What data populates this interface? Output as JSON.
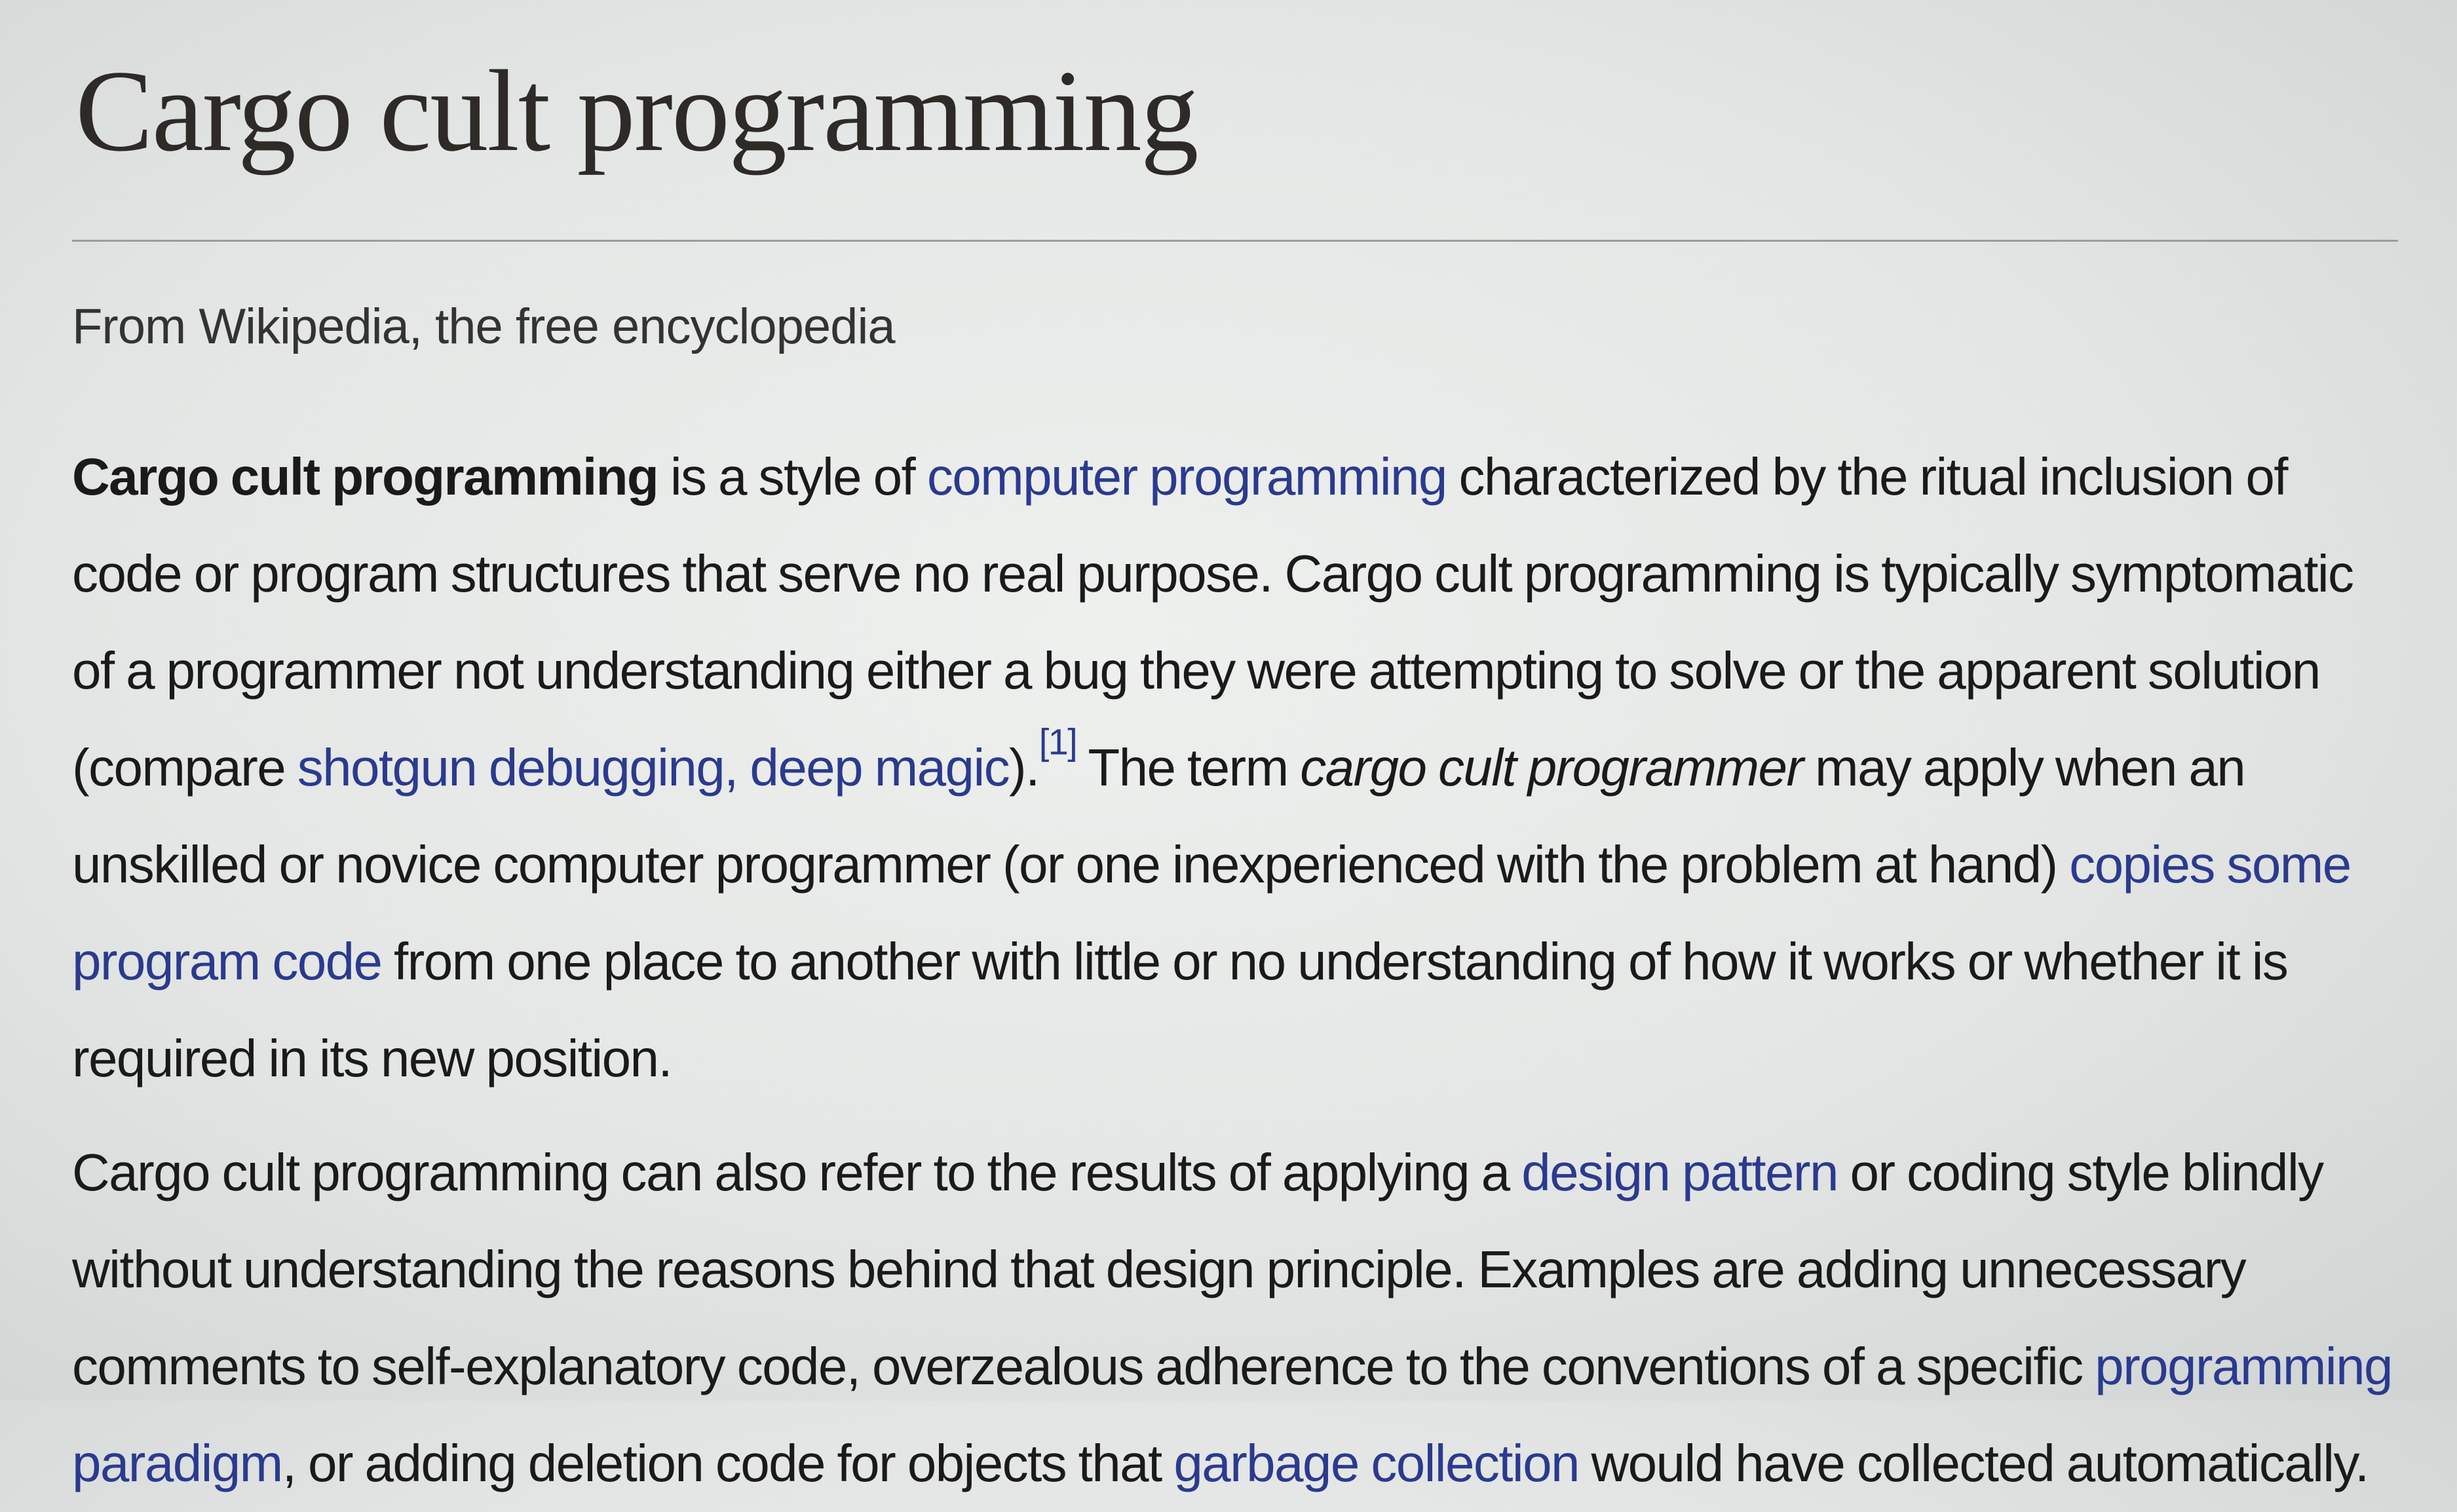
{
  "article": {
    "title": "Cargo cult programming",
    "tagline": "From Wikipedia, the free encyclopedia"
  },
  "paragraph1": {
    "bold_term": "Cargo cult programming",
    "t1": " is a style of ",
    "link_computer_programming": "computer programming",
    "t2": " characterized by the ritual inclusion of code or program structures that serve no real purpose. Cargo cult programming is typically symptomatic of a programmer not understanding either a bug they were attempting to solve or the apparent solution (compare ",
    "link_shotgun_debugging": "shotgun debugging",
    "t3": ", ",
    "link_deep_magic": "deep magic",
    "t4": ").",
    "citation": "[1]",
    "t5": " The term ",
    "italic_term": "cargo cult programmer",
    "t6": " may apply when an unskilled or novice computer programmer (or one inexperienced with the problem at hand) ",
    "link_copies_code": "copies some program code",
    "t7": " from one place to another with little or no understanding of how it works or whether it is required in its new position."
  },
  "paragraph2": {
    "t1": "Cargo cult programming can also refer to the results of applying a ",
    "link_design_pattern": "design pattern",
    "t2": " or coding style blindly without understanding the reasons behind that design principle. Examples are adding unnecessary comments to self-explanatory code, overzealous adherence to the conventions of a specific ",
    "link_programming_paradigm": "programming paradigm",
    "t3": ", or adding deletion code for objects that ",
    "link_garbage_collection": "garbage collection",
    "t4": " would have collected automatically."
  },
  "colors": {
    "link": "#2b3a8f",
    "text": "#1a1a1a",
    "title": "#2e2a28"
  }
}
